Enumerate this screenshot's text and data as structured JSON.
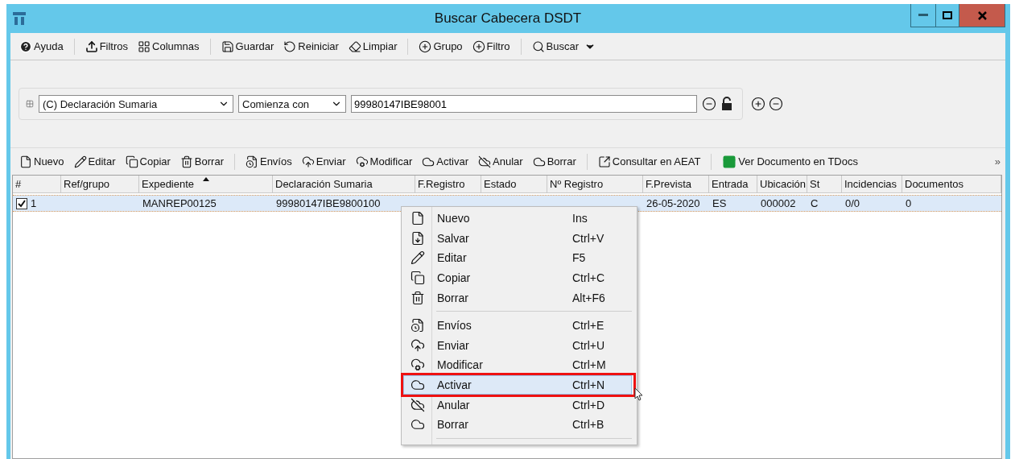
{
  "window": {
    "title": "Buscar Cabecera DSDT"
  },
  "main_toolbar": {
    "groups": [
      [
        "Ayuda"
      ],
      [
        "Filtros",
        "Columnas"
      ],
      [
        "Guardar",
        "Reiniciar",
        "Limpiar"
      ],
      [
        "Grupo",
        "Filtro"
      ],
      [
        "Buscar"
      ]
    ]
  },
  "filter": {
    "field": "(C) Declaración Sumaria",
    "operator": "Comienza con",
    "value": "99980147IBE98001",
    "locked": false
  },
  "record_toolbar": {
    "groups": [
      [
        "Nuevo",
        "Editar",
        "Copiar",
        "Borrar"
      ],
      [
        "Envíos",
        "Enviar",
        "Modificar",
        "Activar",
        "Anular",
        "Borrar"
      ],
      [
        "Consultar en AEAT"
      ],
      [
        "Ver Documento en TDocs"
      ]
    ],
    "overflow": "»"
  },
  "table": {
    "columns": [
      {
        "label": "#",
        "sorted": false
      },
      {
        "label": "Ref/grupo",
        "sorted": false
      },
      {
        "label": "Expediente",
        "sorted": true
      },
      {
        "label": "Declaración Sumaria",
        "sorted": false
      },
      {
        "label": "F.Registro",
        "sorted": false
      },
      {
        "label": "Estado",
        "sorted": false
      },
      {
        "label": "Nº Registro",
        "sorted": false
      },
      {
        "label": "F.Prevista",
        "sorted": false
      },
      {
        "label": "Entrada",
        "sorted": false
      },
      {
        "label": "Ubicación",
        "sorted": false
      },
      {
        "label": "St",
        "sorted": false
      },
      {
        "label": "Incidencias",
        "sorted": false
      },
      {
        "label": "Documentos",
        "sorted": false
      }
    ],
    "rows": [
      {
        "checked": true,
        "selected": true,
        "cells": [
          "1",
          null,
          "MANREP00125",
          "99980147IBE9800100",
          null,
          null,
          null,
          "26-05-2020",
          "ES",
          "000002",
          "C",
          "0/0",
          "0"
        ]
      }
    ]
  },
  "context_menu": {
    "items": [
      {
        "kind": "item",
        "label": "Nuevo",
        "shortcut": "Ins",
        "selected": false
      },
      {
        "kind": "item",
        "label": "Salvar",
        "shortcut": "Ctrl+V",
        "selected": false
      },
      {
        "kind": "item",
        "label": "Editar",
        "shortcut": "F5",
        "selected": false
      },
      {
        "kind": "item",
        "label": "Copiar",
        "shortcut": "Ctrl+C",
        "selected": false
      },
      {
        "kind": "item",
        "label": "Borrar",
        "shortcut": "Alt+F6",
        "selected": false
      },
      {
        "kind": "separator"
      },
      {
        "kind": "item",
        "label": "Envíos",
        "shortcut": "Ctrl+E",
        "selected": false
      },
      {
        "kind": "item",
        "label": "Enviar",
        "shortcut": "Ctrl+U",
        "selected": false
      },
      {
        "kind": "item",
        "label": "Modificar",
        "shortcut": "Ctrl+M",
        "selected": false
      },
      {
        "kind": "item",
        "label": "Activar",
        "shortcut": "Ctrl+N",
        "selected": true
      },
      {
        "kind": "item",
        "label": "Anular",
        "shortcut": "Ctrl+D",
        "selected": false
      },
      {
        "kind": "item",
        "label": "Borrar",
        "shortcut": "Ctrl+B",
        "selected": false
      },
      {
        "kind": "separator"
      }
    ]
  }
}
